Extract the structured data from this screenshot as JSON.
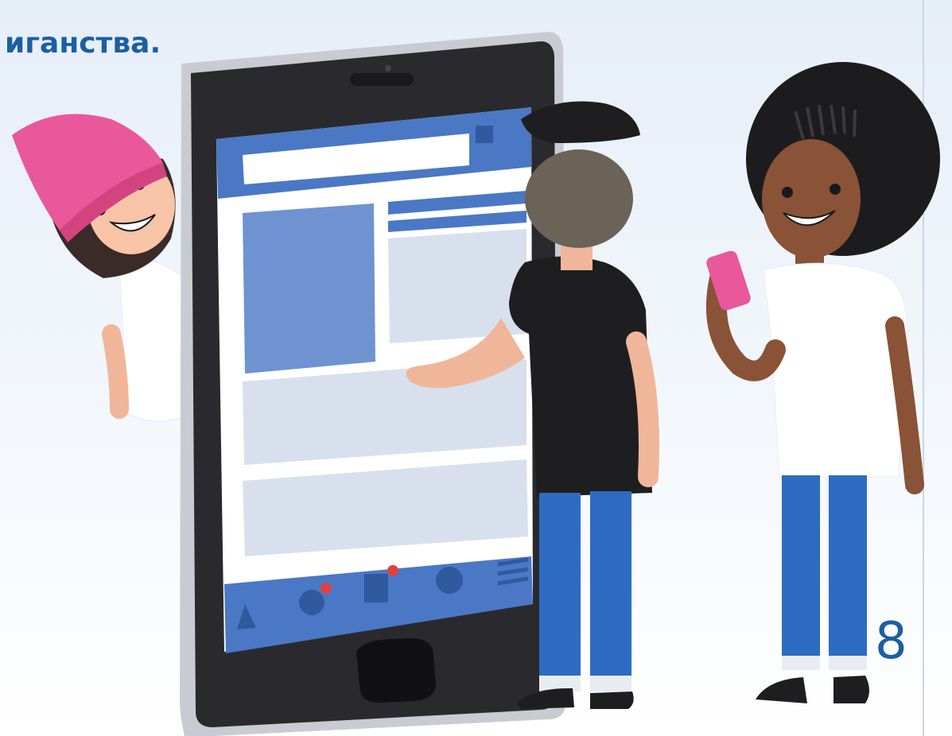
{
  "heading": {
    "line1": "",
    "line2": "иганства."
  },
  "page_number": "8",
  "colors": {
    "accent_blue": "#1b5fa3",
    "phone_body": "#2a2a2e",
    "phone_screen_ui": "#4a78c4",
    "hat_pink": "#e8589a",
    "jeans_blue": "#2e6bc2",
    "notification_red": "#e04040"
  },
  "illustration": {
    "icons": [
      "phone-illustration",
      "girl-pink-hat",
      "boy-back-view",
      "girl-afro-holding-phone"
    ]
  }
}
